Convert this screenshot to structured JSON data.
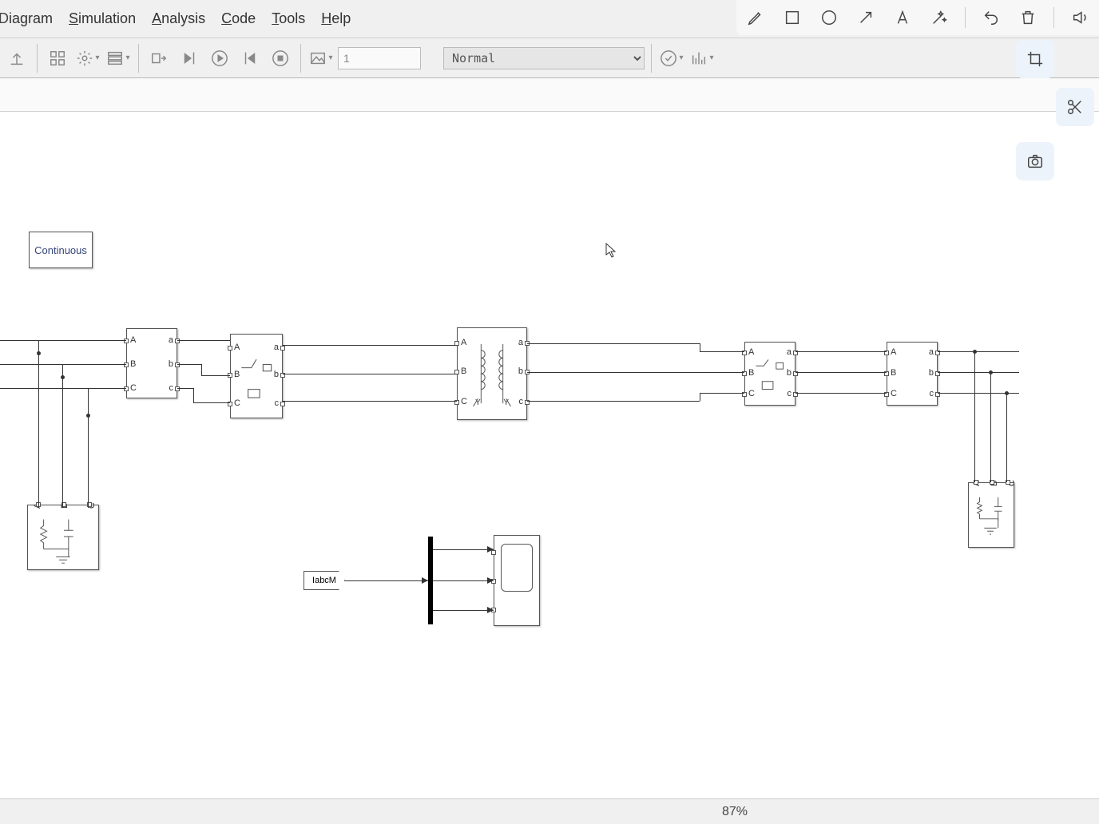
{
  "menu": {
    "diagram": "Diagram",
    "simulation": "Simulation",
    "analysis": "Analysis",
    "code": "Code",
    "tools": "Tools",
    "help": "Help"
  },
  "toolbar": {
    "stop_time": "1",
    "mode": "Normal"
  },
  "blocks": {
    "powergui": "Continuous",
    "labcm_tag": "IabcM",
    "portA": "A",
    "portB": "B",
    "portC": "C",
    "porta": "a",
    "portb": "b",
    "portc": "c",
    "wyeY": "Y"
  },
  "status": {
    "zoom": "87%"
  }
}
